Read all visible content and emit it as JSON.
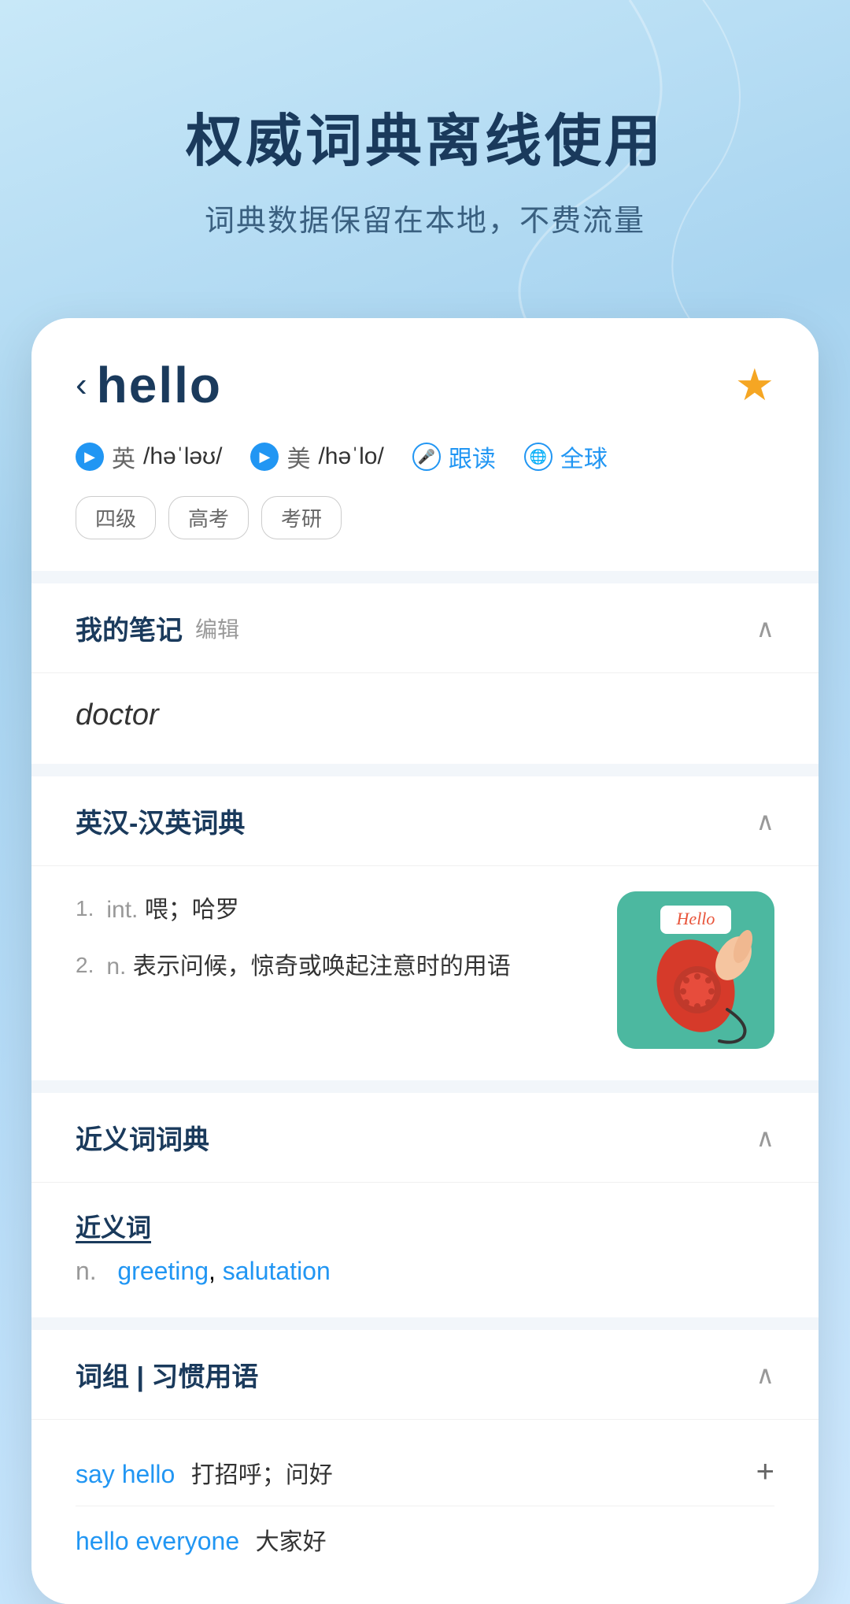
{
  "hero": {
    "title": "权威词典离线使用",
    "subtitle": "词典数据保留在本地，不费流量"
  },
  "word": {
    "back_symbol": "‹",
    "text": "hello",
    "star": "★",
    "pronunciations": [
      {
        "flag": "英",
        "ipa": "/həˈləʊ/"
      },
      {
        "flag": "美",
        "ipa": "/həˈlo/"
      }
    ],
    "follow_read": "跟读",
    "global": "全球",
    "tags": [
      "四级",
      "高考",
      "考研"
    ]
  },
  "notes_section": {
    "title": "我的笔记",
    "edit": "编辑",
    "content": "doctor",
    "collapse": "^"
  },
  "dictionary_section": {
    "title": "英汉-汉英词典",
    "collapse": "^",
    "definitions": [
      {
        "num": "1.",
        "pos": "int.",
        "text": "喂；哈罗"
      },
      {
        "num": "2.",
        "pos": "n.",
        "text": "表示问候，惊奇或唤起注意时的用语"
      }
    ]
  },
  "synonym_section": {
    "title": "近义词词典",
    "collapse": "^",
    "synonym_label": "近义词",
    "pos": "n.",
    "words": [
      "greeting",
      "salutation"
    ]
  },
  "phrase_section": {
    "title": "词组 | 习惯用语",
    "collapse": "^",
    "phrases": [
      {
        "en": "say hello",
        "cn": "打招呼；问好"
      },
      {
        "en": "hello everyone",
        "cn": "大家好"
      }
    ]
  }
}
